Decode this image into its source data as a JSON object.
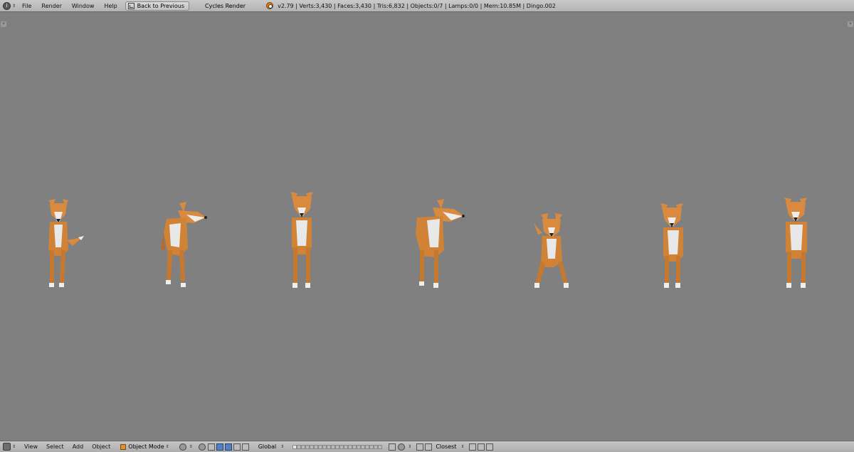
{
  "topbar": {
    "menus": [
      "File",
      "Render",
      "Window",
      "Help"
    ],
    "back_label": "Back to Previous",
    "render_engine": "Cycles Render",
    "stats": "v2.79 | Verts:3,430 | Faces:3,430 | Tris:6,832 | Objects:0/7 | Lamps:0/0 | Mem:10.85M | Dingo.002"
  },
  "bottombar": {
    "menus": [
      "View",
      "Select",
      "Add",
      "Object"
    ],
    "mode": "Object Mode",
    "transform_orientation": "Global",
    "snap_element": "Closest"
  },
  "colors": {
    "viewport": "#808080",
    "fur": "#d98a3e",
    "fur_dark": "#b86a28",
    "belly": "#e8e8e8"
  }
}
